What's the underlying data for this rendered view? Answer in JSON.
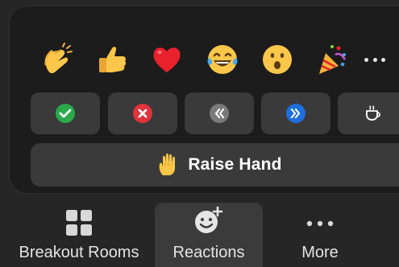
{
  "reactions": {
    "emojis": [
      {
        "name": "clap",
        "icon": "clapping-hands-icon"
      },
      {
        "name": "thumbs-up",
        "icon": "thumbs-up-icon"
      },
      {
        "name": "heart",
        "icon": "red-heart-icon"
      },
      {
        "name": "joy",
        "icon": "tears-of-joy-icon"
      },
      {
        "name": "open-mouth",
        "icon": "surprised-face-icon"
      },
      {
        "name": "tada",
        "icon": "party-popper-icon"
      }
    ],
    "more_icon": "more-dots-icon",
    "status_buttons": [
      {
        "name": "yes",
        "icon": "green-check-icon",
        "color": "#2aa84a"
      },
      {
        "name": "no",
        "icon": "red-x-icon",
        "color": "#e0333a"
      },
      {
        "name": "slow-down",
        "icon": "slow-down-icon",
        "color": "#7a7a7a"
      },
      {
        "name": "speed-up",
        "icon": "speed-up-icon",
        "color": "#1d6fe0"
      },
      {
        "name": "coffee",
        "icon": "coffee-cup-icon",
        "color": "#ffffff"
      }
    ],
    "raise_hand": {
      "label": "Raise Hand",
      "icon": "raised-hand-icon"
    }
  },
  "toolbar": {
    "breakout_rooms": {
      "label": "Breakout Rooms",
      "icon": "grid-icon"
    },
    "reactions": {
      "label": "Reactions",
      "icon": "add-reaction-icon",
      "active": true
    },
    "more": {
      "label": "More",
      "icon": "ellipsis-icon"
    }
  },
  "colors": {
    "panel_bg": "#1c1c1c",
    "button_bg": "#3a3a3a",
    "toolbar_bg": "#262626",
    "active_bg": "#3b3b3b",
    "text": "#e4e4e4"
  }
}
